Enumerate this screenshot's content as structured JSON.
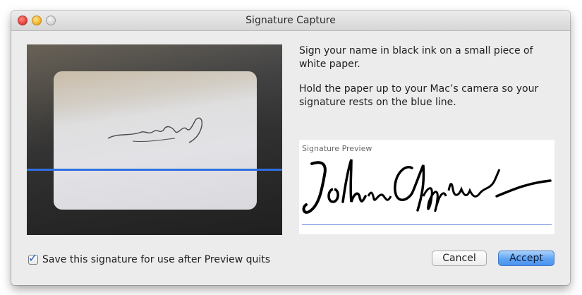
{
  "window": {
    "title": "Signature Capture"
  },
  "titlebar_buttons": [
    {
      "name": "close",
      "color": "#e2463f"
    },
    {
      "name": "minimize",
      "color": "#f3b533"
    },
    {
      "name": "zoom",
      "color": "#d8d8d8"
    }
  ],
  "camera": {
    "guide_line_color": "#2f6fe0"
  },
  "instructions": {
    "line1": "Sign your name in black ink on a small piece of white paper.",
    "line2": "Hold the paper up to your Mac’s camera so your signature rests on the blue line."
  },
  "preview": {
    "label": "Signature Preview"
  },
  "save_option": {
    "label": "Save this signature for use after Preview quits",
    "checked": true
  },
  "buttons": {
    "cancel": "Cancel",
    "accept": "Accept"
  },
  "colors": {
    "accent": "#5fa4f3",
    "window_bg": "#ececec"
  }
}
